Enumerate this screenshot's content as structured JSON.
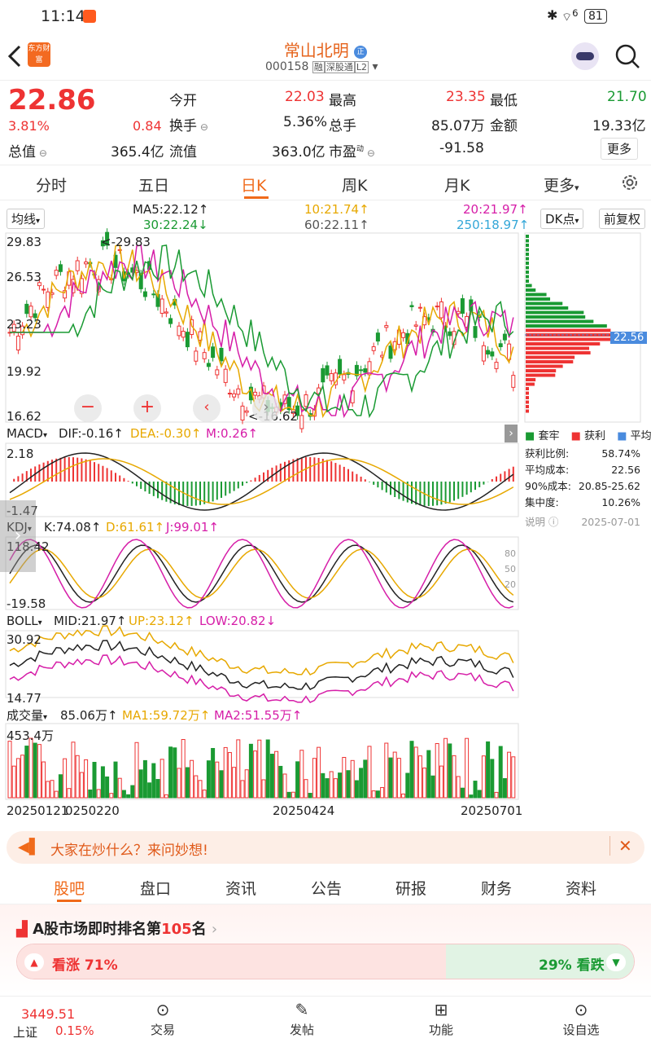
{
  "status": {
    "time": "11:14",
    "battery": "81",
    "signal": "6"
  },
  "nav": {
    "title": "常山北明",
    "code": "000158",
    "badges": [
      "融",
      "深股通",
      "L2"
    ],
    "logo": "东方财富",
    "back_icon": "chevron-left-icon",
    "search_icon": "search-icon",
    "avatar_icon": "robot-avatar-icon"
  },
  "quote": {
    "price": "22.86",
    "pct": "3.81%",
    "chg": "0.84",
    "labels": {
      "open": "今开",
      "high": "最高",
      "low": "最低",
      "turnover": "换手",
      "volume": "总手",
      "amount": "金额",
      "mktcap": "总值",
      "float": "流值",
      "pe": "市盈"
    },
    "values": {
      "open": "22.03",
      "high": "23.35",
      "low": "21.70",
      "turnover": "5.36%",
      "volume": "85.07万",
      "amount": "19.33亿",
      "mktcap": "365.4亿",
      "float": "363.0亿",
      "pe": "-91.58"
    },
    "pe_sup": "动",
    "more": "更多"
  },
  "tabs": [
    "分时",
    "五日",
    "日K",
    "周K",
    "月K",
    "更多"
  ],
  "active_tab": "日K",
  "ma": {
    "selector": "均线",
    "ma5": "MA5:22.12↑",
    "ma10": "10:21.74↑",
    "ma20": "20:21.97↑",
    "ma30": "30:22.24↓",
    "ma60": "60:22.11↑",
    "ma250": "250:18.97↑"
  },
  "chip": {
    "dk": "DK点",
    "fq": "前复权",
    "price": "22.56",
    "legend": [
      "套牢",
      "获利",
      "平均"
    ],
    "rows": [
      {
        "k": "获利比例:",
        "v": "58.74%"
      },
      {
        "k": "平均成本:",
        "v": "22.56"
      },
      {
        "k": "90%成本:",
        "v": "20.85-25.62"
      },
      {
        "k": "集中度:",
        "v": "10.26%"
      }
    ],
    "note": "说明",
    "date": "2025-07-01"
  },
  "main": {
    "ymax": "29.83",
    "y2": "26.53",
    "y3": "23.23",
    "y4": "19.92",
    "ymin": "16.62",
    "hi_label": "<-29.83",
    "lo_label": "<-16.62"
  },
  "macd": {
    "name": "MACD",
    "dif": "DIF:-0.16↑",
    "dea": "DEA:-0.30↑",
    "m": "M:0.26↑",
    "ymax": "2.18",
    "ymin": "-1.47"
  },
  "kdj": {
    "name": "KDJ",
    "k": "K:74.08↑",
    "d": "D:61.61↑",
    "j": "J:99.01↑",
    "ymax": "118.42",
    "ymin": "-19.58",
    "levels": [
      "80",
      "50",
      "20"
    ]
  },
  "boll": {
    "name": "BOLL",
    "mid": "MID:21.97↑",
    "up": "UP:23.12↑",
    "low": "LOW:20.82↓",
    "ymax": "30.92",
    "ymin": "14.77"
  },
  "vol": {
    "name": "成交量",
    "v": "85.06万↑",
    "ma1": "MA1:59.72万↑",
    "ma2": "MA2:51.55万↑",
    "ymax": "453.4万"
  },
  "dates": [
    "20250121",
    "0250220",
    "20250424",
    "20250701"
  ],
  "banner": {
    "text": "大家在炒什么？来问妙想!"
  },
  "bottom_tabs": [
    "股吧",
    "盘口",
    "资讯",
    "公告",
    "研报",
    "财务",
    "资料"
  ],
  "rank": {
    "text": "A股市场即时排名第",
    "num": "105",
    "suffix": "名",
    "up": "看涨 71%",
    "down": "29% 看跌"
  },
  "index": {
    "value": "3449.51",
    "name": "上证",
    "pct": "0.15%"
  },
  "bottom_bar": [
    "交易",
    "发帖",
    "功能",
    "设自选"
  ],
  "colors": {
    "up": "#e33333",
    "down": "#1a9a33",
    "accent": "#ff6a00"
  }
}
